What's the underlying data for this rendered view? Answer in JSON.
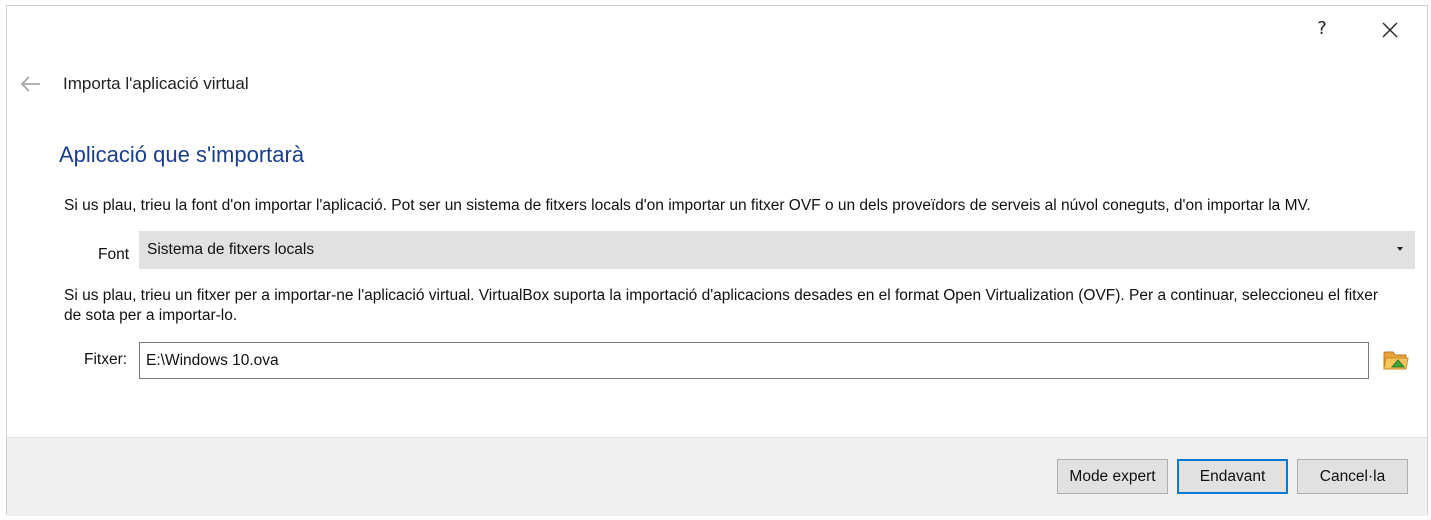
{
  "titlebar": {
    "help_label": "?"
  },
  "wizard": {
    "title": "Importa l'aplicació virtual"
  },
  "page": {
    "heading": "Aplicació que s'importarà",
    "source_description": "Si us plau, trieu la font d'on importar l'aplicació. Pot ser un sistema de fitxers locals d'on importar un fitxer OVF o un dels proveïdors de serveis al núvol coneguts, d'on importar la MV.",
    "source_label": "Font",
    "source_value": "Sistema de fitxers locals",
    "file_description": "Si us plau, trieu un fitxer per a importar-ne l'aplicació virtual. VirtualBox suporta la importació d'aplicacions desades en el format Open Virtualization (OVF). Per a continuar, seleccioneu el fitxer de sota per a importar-lo.",
    "file_label": "Fitxer:",
    "file_value": "E:\\Windows 10.ova"
  },
  "footer": {
    "expert_label": "Mode expert",
    "next_label": "Endavant",
    "cancel_label": "Cancel·la"
  },
  "icons": {
    "back": "arrow-left-icon",
    "close": "close-icon",
    "folder": "folder-open-icon",
    "dropdown": "chevron-down-icon"
  },
  "colors": {
    "heading": "#1a3e8c",
    "default_button_border": "#0078d7",
    "footer_bg": "#f0f0f0",
    "combo_bg": "#e1e1e1"
  }
}
